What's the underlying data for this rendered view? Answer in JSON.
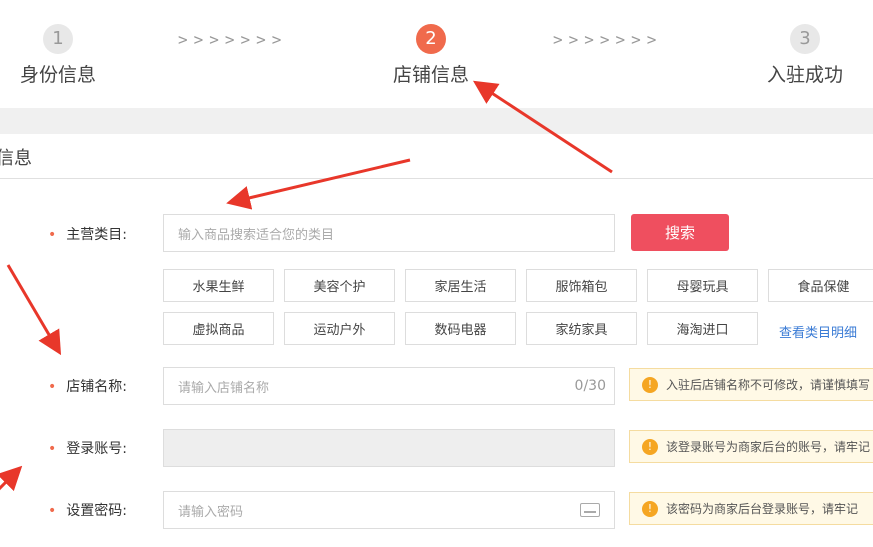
{
  "steps": [
    {
      "number": "1",
      "label": "身份信息"
    },
    {
      "number": "2",
      "label": "店铺信息"
    },
    {
      "number": "3",
      "label": "入驻成功"
    }
  ],
  "step_separator": ">>>>>>>",
  "section_title": "信息",
  "main_category": {
    "label": "主营类目:",
    "placeholder": "输入商品搜索适合您的类目",
    "search_button": "搜索",
    "categories": [
      "水果生鲜",
      "美容个护",
      "家居生活",
      "服饰箱包",
      "母婴玩具",
      "食品保健",
      "虚拟商品",
      "运动户外",
      "数码电器",
      "家纺家具",
      "海淘进口"
    ],
    "view_link": "查看类目明细"
  },
  "shop_name": {
    "label": "店铺名称:",
    "placeholder": "请输入店铺名称",
    "counter": "0/30",
    "tip": "入驻后店铺名称不可修改，请谨慎填写"
  },
  "login_account": {
    "label": "登录账号:",
    "value": "",
    "tip": "该登录账号为商家后台的账号，请牢记"
  },
  "password": {
    "label": "设置密码:",
    "placeholder": "请输入密码",
    "tip": "该密码为商家后台登录账号，请牢记"
  },
  "colors": {
    "accent": "#f06a4c",
    "search_button": "#ef4f5f",
    "link": "#3a7bd5",
    "tip_bg": "#fff9e6",
    "annotation_arrow": "#e8372a"
  },
  "icons": {
    "tip": "exclamation-circle-icon",
    "password_field": "keyboard-icon"
  }
}
